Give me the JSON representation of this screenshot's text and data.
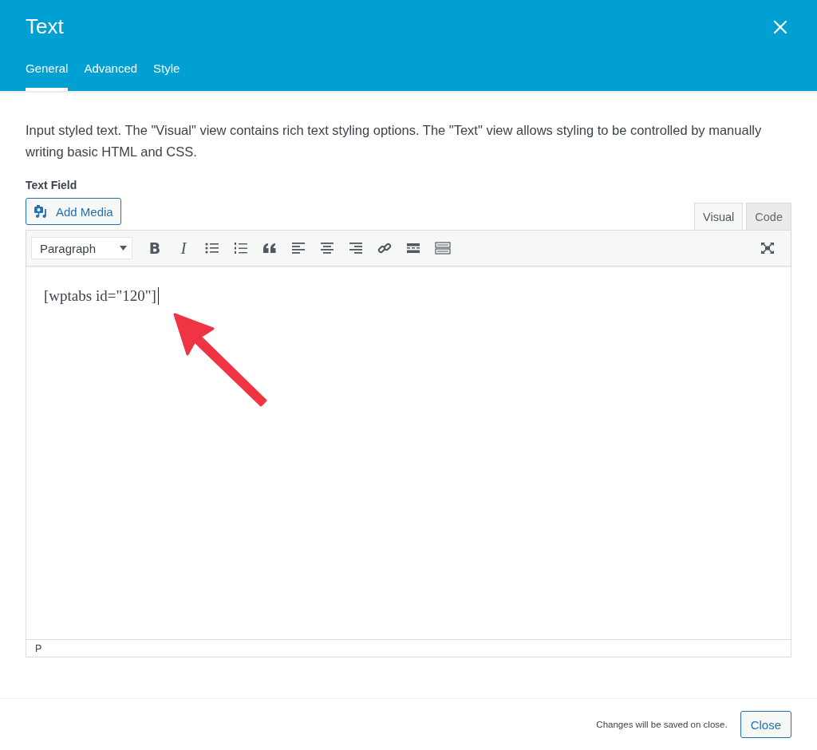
{
  "header": {
    "title": "Text",
    "tabs": [
      {
        "label": "General",
        "selected": true
      },
      {
        "label": "Advanced",
        "selected": false
      },
      {
        "label": "Style",
        "selected": false
      }
    ]
  },
  "description": "Input styled text. The \"Visual\" view contains rich text styling options. The \"Text\" view allows styling to be controlled by manually writing basic HTML and CSS.",
  "field": {
    "label": "Text Field",
    "add_media": "Add Media",
    "editor_tabs": [
      {
        "label": "Visual",
        "selected": true
      },
      {
        "label": "Code",
        "selected": false
      }
    ],
    "toolbar": {
      "format": "Paragraph",
      "bold": "B",
      "italic": "I"
    },
    "content": "[wptabs id=\"120\"]",
    "status_path": "P"
  },
  "footer": {
    "note": "Changes will be saved on close.",
    "close_button": "Close"
  }
}
